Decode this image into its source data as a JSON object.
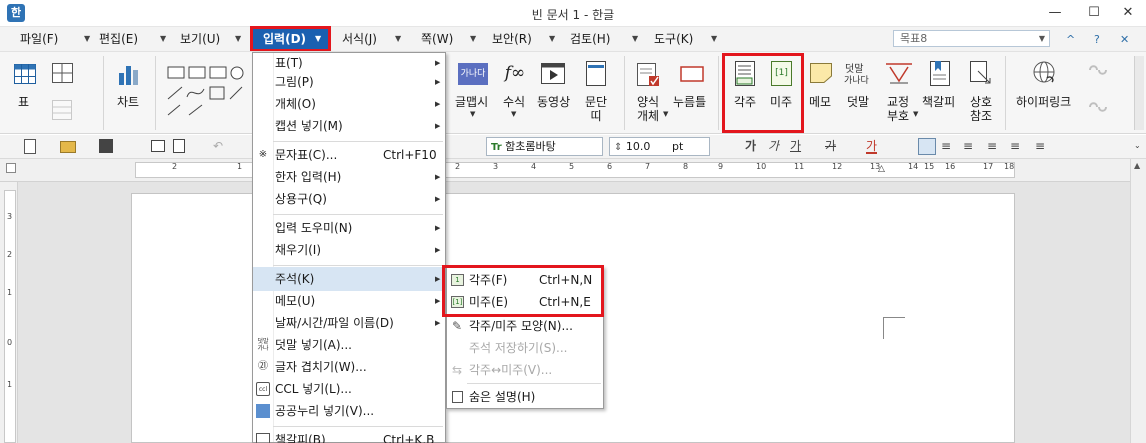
{
  "window": {
    "app_icon": "한",
    "title": "빈 문서 1 - 한글",
    "min_glyph": "—",
    "max_glyph": "☐",
    "close_glyph": "✕"
  },
  "menubar": {
    "items": [
      "파일(F)",
      "편집(E)",
      "보기(U)",
      "입력(D)",
      "서식(J)",
      "쪽(W)",
      "보안(R)",
      "검토(H)",
      "도구(K)"
    ],
    "arrow": "▼",
    "style_combo": "목표8",
    "topright": [
      "^",
      "?",
      "✕"
    ]
  },
  "ribbon": {
    "table": "표",
    "chart": "차트",
    "glyph": "글맵시",
    "formula": "수식",
    "video": "동영상",
    "paragraph": "문단\n띠",
    "form": "양식\n개체",
    "press": "누름틀",
    "footnote": "각주",
    "endnote": "미주",
    "memo": "메모",
    "overlay": "덧말",
    "overlay_icon_top": "덧말",
    "overlay_icon_bottom": "가나다",
    "proof": "교정\n부호",
    "bookmark": "책갈피",
    "crossref": "상호\n참조",
    "hyperlink": "하이퍼링크",
    "formula_icon": "f∞",
    "glyph_icon": "가나다"
  },
  "formatting": {
    "font": "함초롬바탕",
    "size": "10.0",
    "unit": "pt",
    "bold": "가",
    "italic": "가",
    "underline": "가",
    "strike": "가",
    "color": "가"
  },
  "ruler": {
    "h_labels": [
      "2",
      "1",
      "2",
      "3",
      "4",
      "5",
      "6",
      "7",
      "8",
      "9",
      "10",
      "11",
      "12",
      "13",
      "14",
      "15",
      "16",
      "17",
      "18"
    ],
    "v_labels": [
      "3",
      "2",
      "1",
      "0",
      "1"
    ]
  },
  "dropdown": {
    "items": [
      {
        "label": "표(T)",
        "shortcut": "",
        "arrow": "▶"
      },
      {
        "label": "그림(P)",
        "shortcut": "",
        "arrow": "▶"
      },
      {
        "label": "개체(O)",
        "shortcut": "",
        "arrow": "▶"
      },
      {
        "label": "캡션 넣기(M)",
        "shortcut": "",
        "arrow": "▶"
      },
      {
        "label": "문자표(C)...",
        "shortcut": "Ctrl+F10",
        "arrow": ""
      },
      {
        "label": "한자 입력(H)",
        "shortcut": "",
        "arrow": "▶"
      },
      {
        "label": "상용구(Q)",
        "shortcut": "",
        "arrow": "▶"
      },
      {
        "label": "입력 도우미(N)",
        "shortcut": "",
        "arrow": "▶"
      },
      {
        "label": "채우기(I)",
        "shortcut": "",
        "arrow": "▶"
      },
      {
        "label": "주석(K)",
        "shortcut": "",
        "arrow": "▶"
      },
      {
        "label": "메모(U)",
        "shortcut": "",
        "arrow": "▶"
      },
      {
        "label": "날짜/시간/파일 이름(D)",
        "shortcut": "",
        "arrow": "▶"
      },
      {
        "label": "덧말 넣기(A)...",
        "shortcut": "",
        "arrow": ""
      },
      {
        "label": "글자 겹치기(W)...",
        "shortcut": "",
        "arrow": ""
      },
      {
        "label": "CCL 넣기(L)...",
        "shortcut": "",
        "arrow": ""
      },
      {
        "label": "공공누리 넣기(V)...",
        "shortcut": "",
        "arrow": ""
      },
      {
        "label": "책갈피(B)",
        "shortcut": "Ctrl+K,B",
        "arrow": ""
      }
    ],
    "icons": {
      "special": "※",
      "overlap": "㉑",
      "ccl": "ccl",
      "overlay_top": "덧말",
      "overlay_bottom": "가나"
    }
  },
  "submenu": {
    "items": [
      {
        "label": "각주(F)",
        "shortcut": "Ctrl+N,N"
      },
      {
        "label": "미주(E)",
        "shortcut": "Ctrl+N,E"
      },
      {
        "label": "각주/미주 모양(N)...",
        "shortcut": ""
      },
      {
        "label": "주석 저장하기(S)...",
        "shortcut": ""
      },
      {
        "label": "각주↔미주(V)...",
        "shortcut": ""
      },
      {
        "label": "숨은 설명(H)",
        "shortcut": ""
      }
    ],
    "footnote_icon": "1",
    "endnote_icon": "[1]"
  }
}
